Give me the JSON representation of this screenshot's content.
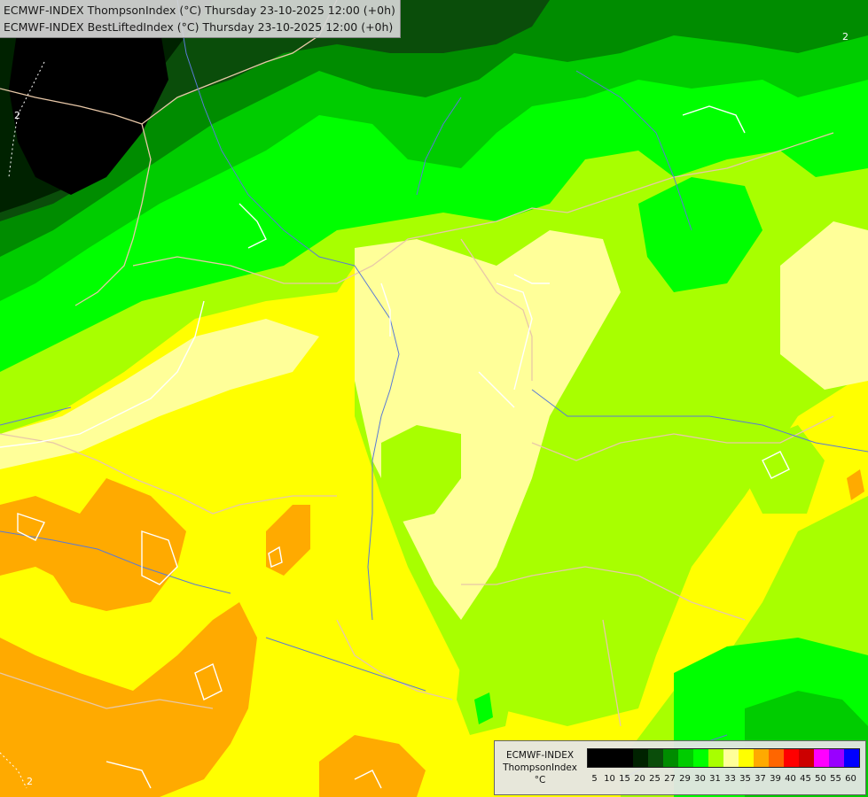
{
  "header": {
    "line1": "ECMWF-INDEX ThompsonIndex (°C) Thursday 23-10-2025 12:00 (+0h)",
    "line2": "ECMWF-INDEX BestLiftedIndex (°C) Thursday 23-10-2025 12:00 (+0h)"
  },
  "map": {
    "contour_labels": [
      "2",
      "2",
      "2"
    ]
  },
  "legend": {
    "model": "ECMWF-INDEX",
    "parameter": "ThompsonIndex",
    "unit": "°C",
    "ticks": [
      "5",
      "10",
      "15",
      "20",
      "25",
      "27",
      "29",
      "30",
      "31",
      "33",
      "35",
      "37",
      "39",
      "40",
      "45",
      "50",
      "55",
      "60"
    ],
    "colors": [
      "#000000",
      "#000000",
      "#000000",
      "#002200",
      "#0a4d0a",
      "#008c00",
      "#00cc00",
      "#00ff00",
      "#a8ff00",
      "#ffff99",
      "#ffff00",
      "#ffaa00",
      "#ff6600",
      "#ff0000",
      "#cc0000",
      "#ff00ff",
      "#9900ff",
      "#0000ff"
    ]
  }
}
